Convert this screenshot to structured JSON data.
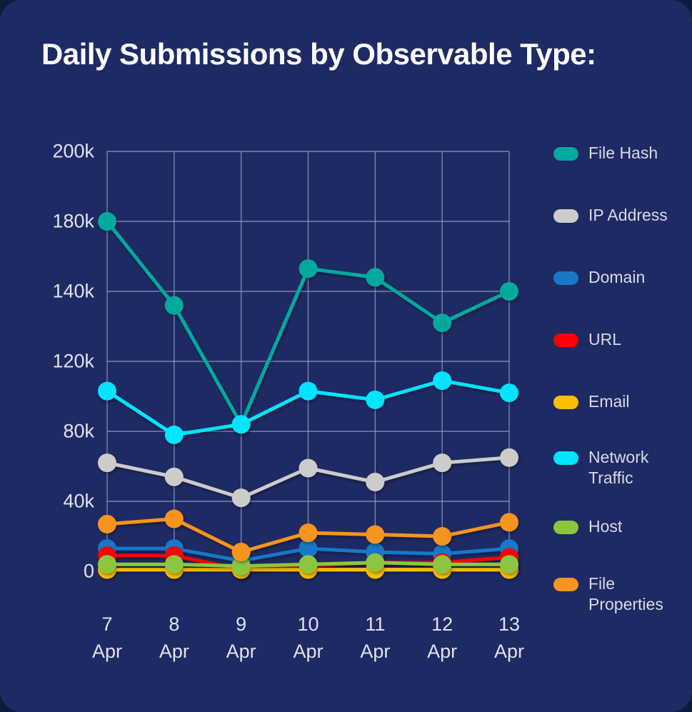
{
  "page": {
    "background_color": "#1e2a63",
    "title": "Daily Submissions by Observable Type:"
  },
  "legend": {
    "position": "right",
    "items": [
      {
        "label": "File Hash",
        "color": "#00a99d"
      },
      {
        "label": "IP Address",
        "color": "#cccccc"
      },
      {
        "label": "Domain",
        "color": "#1878c8"
      },
      {
        "label": "URL",
        "color": "#ff0000"
      },
      {
        "label": "Email",
        "color": "#ffbf00"
      },
      {
        "label": "Network Traffic",
        "color": "#00e5ff"
      },
      {
        "label": "Host",
        "color": "#8cc63f"
      },
      {
        "label": "File Properties",
        "color": "#f7941e"
      }
    ]
  },
  "axes": {
    "y_tick_labels": [
      "200k",
      "180k",
      "140k",
      "120k",
      "80k",
      "40k",
      "0"
    ],
    "x_tick_days": [
      "7",
      "8",
      "9",
      "10",
      "11",
      "12",
      "13"
    ],
    "x_tick_months": [
      "Apr",
      "Apr",
      "Apr",
      "Apr",
      "Apr",
      "Apr",
      "Apr"
    ]
  },
  "chart_data": {
    "type": "line",
    "title": "Daily Submissions by Observable Type:",
    "xlabel": "",
    "ylabel": "",
    "grid": true,
    "legend_position": "right",
    "ylim": [
      0,
      200000
    ],
    "y_ticks": [
      0,
      40000,
      80000,
      120000,
      140000,
      180000,
      200000
    ],
    "y_tick_labels": [
      "0",
      "40k",
      "80k",
      "120k",
      "140k",
      "180k",
      "200k"
    ],
    "categories": [
      "7 Apr",
      "8 Apr",
      "9 Apr",
      "10 Apr",
      "11 Apr",
      "12 Apr",
      "13 Apr"
    ],
    "series": [
      {
        "name": "File Hash",
        "color": "#00a99d",
        "values": [
          180000,
          136000,
          84000,
          153000,
          148000,
          131000,
          140000
        ]
      },
      {
        "name": "IP Address",
        "color": "#cccccc",
        "values": [
          62000,
          54000,
          42000,
          59000,
          51000,
          62000,
          65000
        ]
      },
      {
        "name": "Domain",
        "color": "#1878c8",
        "values": [
          13000,
          13000,
          6000,
          13000,
          11000,
          10000,
          13000
        ]
      },
      {
        "name": "URL",
        "color": "#ff0000",
        "values": [
          9000,
          9000,
          1000,
          3000,
          5000,
          5000,
          8000
        ]
      },
      {
        "name": "Email",
        "color": "#ffbf00",
        "values": [
          1000,
          1000,
          1000,
          1000,
          1000,
          1000,
          1000
        ]
      },
      {
        "name": "Network Traffic",
        "color": "#00e5ff",
        "values": [
          103000,
          78000,
          84000,
          103000,
          98000,
          109000,
          102000
        ]
      },
      {
        "name": "Host",
        "color": "#8cc63f",
        "values": [
          4000,
          4000,
          3000,
          4000,
          5000,
          4000,
          4000
        ]
      },
      {
        "name": "File Properties",
        "color": "#f7941e",
        "values": [
          27000,
          30000,
          11000,
          22000,
          21000,
          20000,
          28000
        ]
      }
    ]
  }
}
